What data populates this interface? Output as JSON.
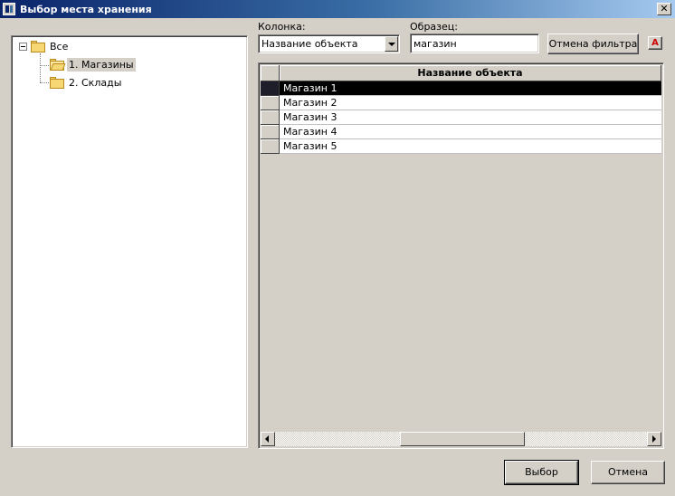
{
  "window": {
    "title": "Выбор места хранения",
    "close_glyph": "✕"
  },
  "tree": {
    "root": {
      "label": "Все",
      "icon": "folder-icon",
      "expanded": true
    },
    "children": [
      {
        "label": "1. Магазины",
        "icon": "folder-open-icon",
        "selected": true
      },
      {
        "label": "2. Склады",
        "icon": "folder-icon",
        "selected": false
      }
    ]
  },
  "filter": {
    "column_label": "Колонка:",
    "column_value": "Название объекта",
    "sample_label": "Образец:",
    "sample_value": "магазин",
    "reset_button": "Отмена фильтра",
    "font_button": "A"
  },
  "grid": {
    "columns": [
      "Название объекта"
    ],
    "rows": [
      {
        "name": "Магазин 1",
        "selected": true
      },
      {
        "name": "Магазин 2",
        "selected": false
      },
      {
        "name": "Магазин 3",
        "selected": false
      },
      {
        "name": "Магазин 4",
        "selected": false
      },
      {
        "name": "Магазин 5",
        "selected": false
      }
    ]
  },
  "buttons": {
    "ok": "Выбор",
    "cancel": "Отмена"
  },
  "colors": {
    "titlebar_start": "#0a246a",
    "titlebar_end": "#a6caf0",
    "face": "#d4d0c8",
    "selection": "#000000",
    "font_button_accent": "#cc0000"
  }
}
